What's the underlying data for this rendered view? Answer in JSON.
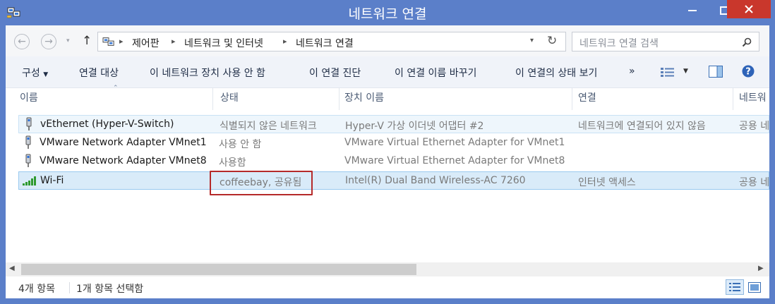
{
  "window": {
    "title": "네트워크 연결"
  },
  "breadcrumb": [
    "제어판",
    "네트워크 및 인터넷",
    "네트워크 연결"
  ],
  "search": {
    "placeholder": "네트워크 연결 검색"
  },
  "toolbar": {
    "organize": "구성",
    "connect_to": "연결 대상",
    "disable": "이 네트워크 장치 사용 안 함",
    "diagnose": "이 연결 진단",
    "rename": "이 연결 이름 바꾸기",
    "status": "이 연결의 상태 보기",
    "more": "»"
  },
  "columns": [
    "이름",
    "상태",
    "장치 이름",
    "연결",
    "네트워"
  ],
  "rows": [
    {
      "name": "vEthernet (Hyper-V-Switch)",
      "status": "식별되지 않은 네트워크",
      "device": "Hyper-V 가상 이더넷 어댑터 #2",
      "connectivity": "네트워크에 연결되어 있지 않음",
      "category": "공용 네"
    },
    {
      "name": "VMware Network Adapter VMnet1",
      "status": "사용 안 함",
      "device": "VMware Virtual Ethernet Adapter for VMnet1",
      "connectivity": "",
      "category": ""
    },
    {
      "name": "VMware Network Adapter VMnet8",
      "status": "사용함",
      "device": "VMware Virtual Ethernet Adapter for VMnet8",
      "connectivity": "",
      "category": ""
    },
    {
      "name": "Wi-Fi",
      "status": "coffeebay, 공유됨",
      "device": "Intel(R) Dual Band Wireless-AC 7260",
      "connectivity": "인터넷 액세스",
      "category": "공용 네"
    }
  ],
  "statusbar": {
    "count": "4개 항목",
    "selected": "1개 항목 선택함"
  },
  "colors": {
    "titlebar": "#5b7fc9",
    "close": "#c9372c",
    "selection": "#d9ebf9",
    "highlight": "#b52a2a"
  },
  "icons": [
    "network-connections-icon",
    "back-arrow-icon",
    "forward-arrow-icon",
    "up-arrow-icon",
    "refresh-icon",
    "search-icon",
    "view-options-icon",
    "preview-pane-icon",
    "help-icon",
    "ethernet-adapter-icon",
    "wifi-signal-icon",
    "details-view-icon",
    "large-icons-view-icon"
  ]
}
